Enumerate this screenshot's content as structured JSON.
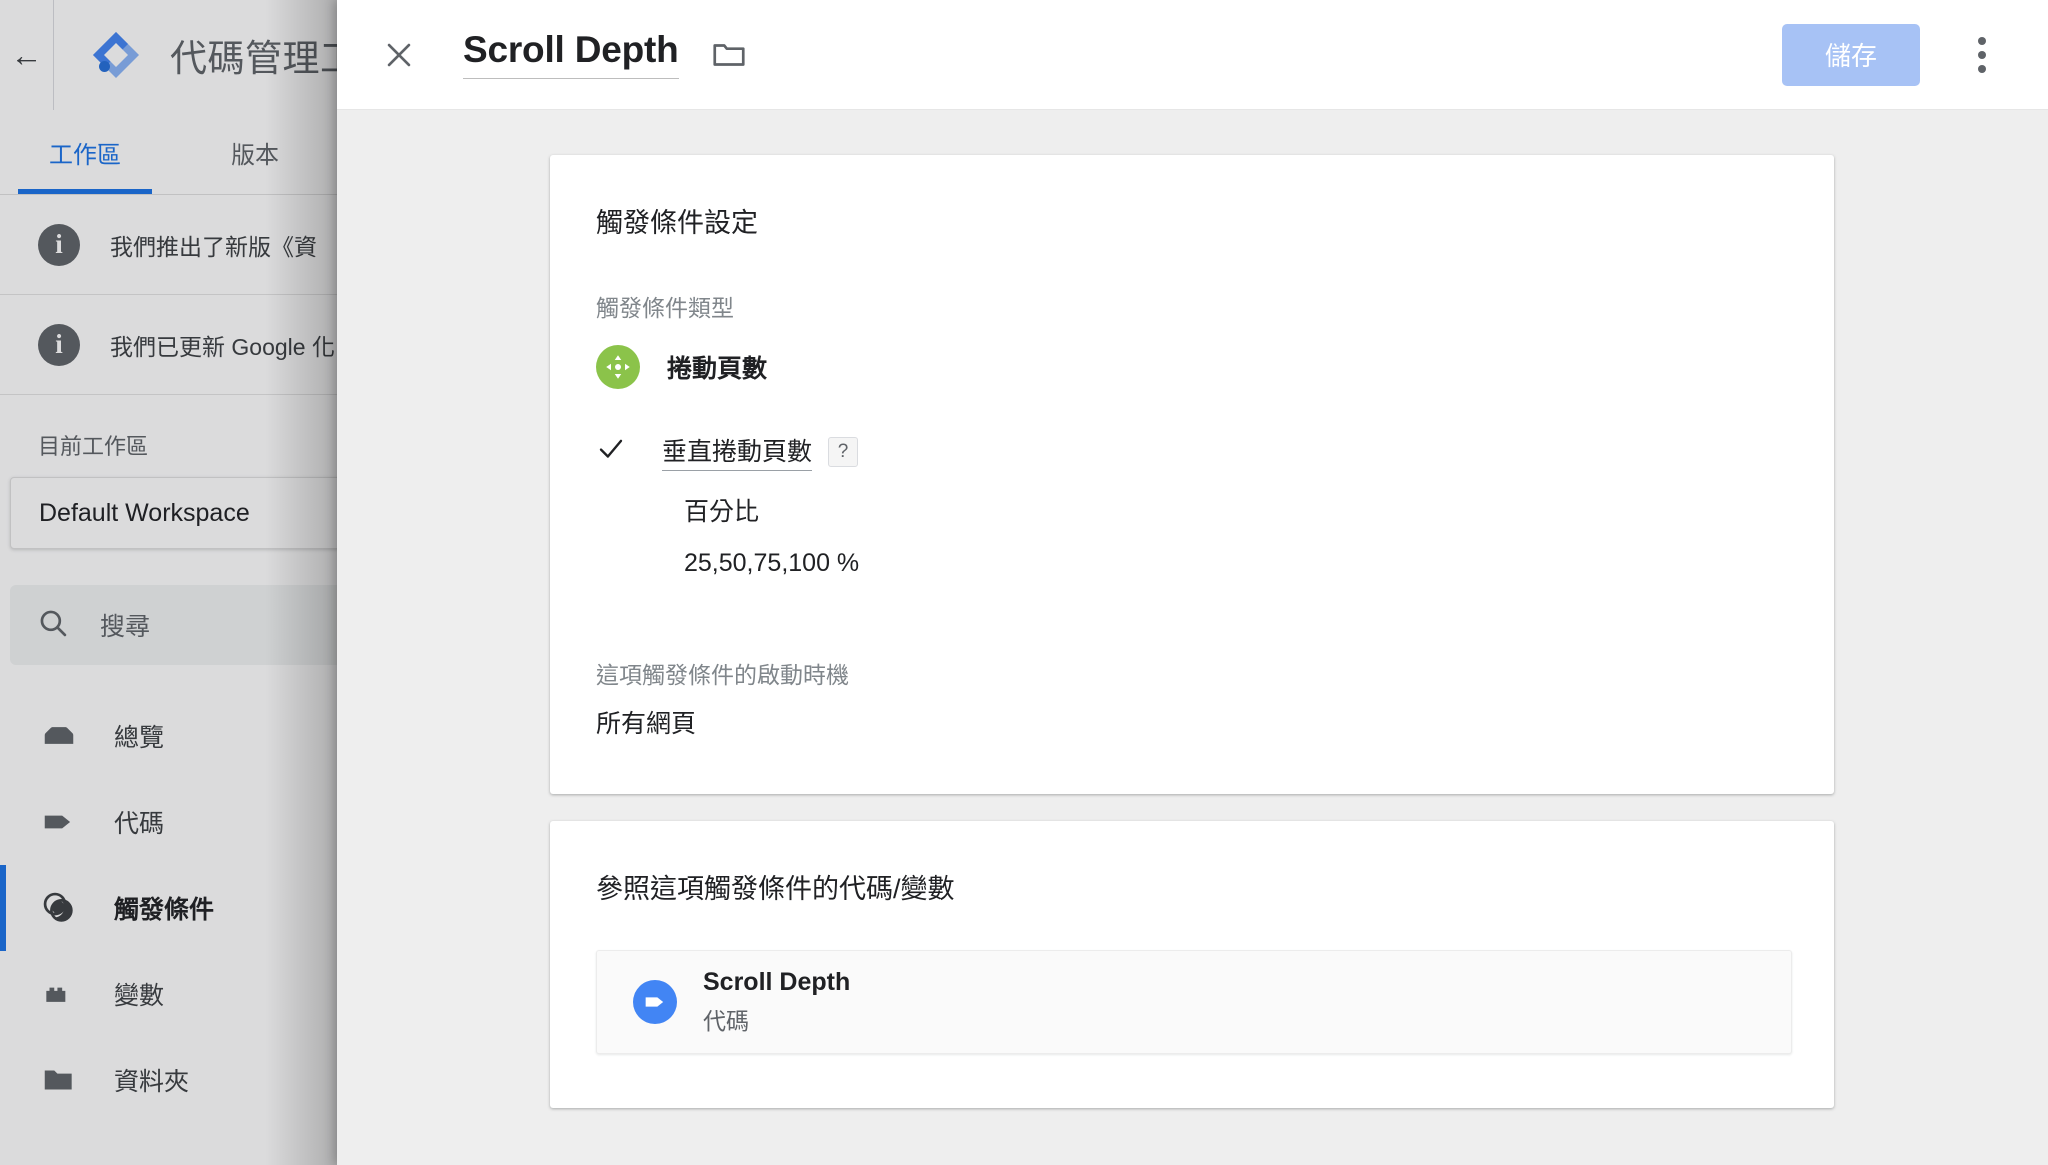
{
  "app": {
    "back_icon": "back-arrow-icon",
    "logo_icon": "google-tag-manager-logo",
    "title": "代碼管理工具"
  },
  "sidebar": {
    "tabs": [
      {
        "label": "工作區",
        "active": true
      },
      {
        "label": "版本",
        "active": false
      }
    ],
    "notices": [
      {
        "icon": "info-icon",
        "text": "我們推出了新版《資"
      },
      {
        "icon": "info-icon",
        "text": "我們已更新 Google 化"
      }
    ],
    "workspace": {
      "label": "目前工作區",
      "value": "Default Workspace"
    },
    "search": {
      "icon": "search-icon",
      "placeholder": "搜尋"
    },
    "items": [
      {
        "label": "總覽",
        "icon": "overview-icon",
        "active": false
      },
      {
        "label": "代碼",
        "icon": "tag-icon",
        "active": false
      },
      {
        "label": "觸發條件",
        "icon": "trigger-icon",
        "active": true
      },
      {
        "label": "變數",
        "icon": "variable-icon",
        "active": false
      },
      {
        "label": "資料夾",
        "icon": "folder-icon",
        "active": false
      }
    ]
  },
  "dialog": {
    "close_icon": "close-icon",
    "title": "Scroll Depth",
    "folder_icon": "folder-icon",
    "save_label": "儲存",
    "save_disabled": true,
    "menu_icon": "more-vert-icon",
    "trigger_card": {
      "heading": "觸發條件設定",
      "type_label": "觸發條件類型",
      "type_icon": "scroll-depth-icon",
      "type_name": "捲動頁數",
      "check_icon": "checkmark-icon",
      "check_title": "垂直捲動頁數",
      "help_icon": "help-icon",
      "help_glyph": "?",
      "check_sub": "百分比",
      "check_value": "25,50,75,100 %",
      "fire_label": "這項觸發條件的啟動時機",
      "fire_value": "所有網頁"
    },
    "references_card": {
      "heading": "參照這項觸發條件的代碼/變數",
      "rows": [
        {
          "icon": "tag-icon",
          "name": "Scroll Depth",
          "type": "代碼"
        }
      ]
    }
  },
  "colors": {
    "accent_blue": "#1a73e8",
    "save_disabled_blue": "#a7c2f5",
    "trigger_green": "#8bc34a",
    "tag_blue": "#4285f4",
    "panel_bg": "#eeeeee"
  }
}
